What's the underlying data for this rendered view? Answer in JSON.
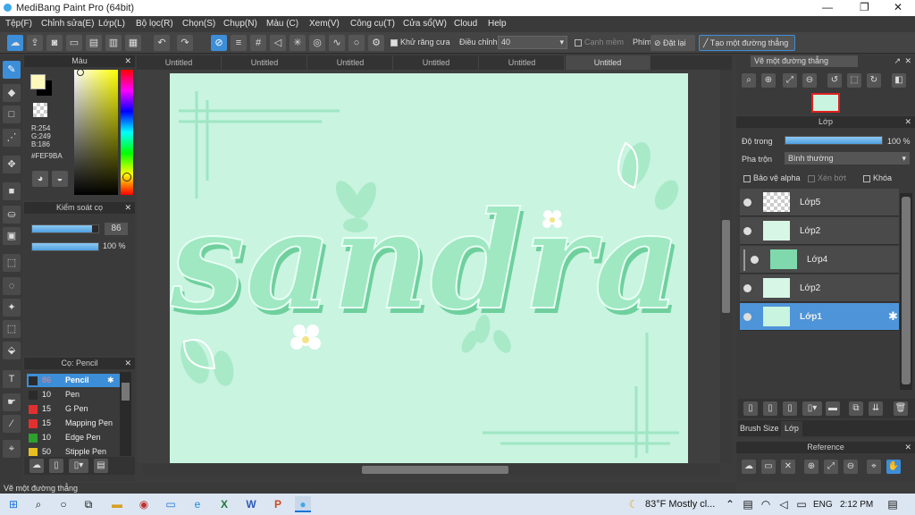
{
  "window": {
    "title": "MediBang Paint Pro (64bit)",
    "min": "—",
    "max": "❐",
    "close": "✕"
  },
  "menu": [
    "Tệp(F)",
    "Chỉnh sửa(E)",
    "Lớp(L)",
    "Bộ lọc(R)",
    "Chọn(S)",
    "Chụp(N)",
    "Màu (C)",
    "Xem(V)",
    "Công cụ(T)",
    "Cửa sổ(W)",
    "Cloud",
    "Help"
  ],
  "toolbar": {
    "antialias_label": "Khử răng cưa",
    "adjust_label": "Điều chỉnh",
    "adjust_value": "40",
    "smooth_label": "Cạnh mềm",
    "key_label": "Phím",
    "reset_label": "Đặt lại",
    "line_label": "Tạo một đường thẳng"
  },
  "color_panel": {
    "title": "Màu",
    "r": "R:254",
    "g": "G:249",
    "b": "B:186",
    "hex": "#FEF9BA",
    "fg_color": "#fef9ba",
    "bg_color": "#000000"
  },
  "brush_control": {
    "title": "Kiểm soát cọ",
    "size": "86",
    "opacity": "100 %",
    "size_fraction": 0.9,
    "opacity_fraction": 1.0
  },
  "brush_panel": {
    "title": "Cọ: Pencil",
    "items": [
      {
        "num": "86",
        "name": "Pencil",
        "color": "#2b2b2b"
      },
      {
        "num": "10",
        "name": "Pen",
        "color": "#2b2b2b"
      },
      {
        "num": "15",
        "name": "G Pen",
        "color": "#e23030"
      },
      {
        "num": "15",
        "name": "Mapping Pen",
        "color": "#e23030"
      },
      {
        "num": "10",
        "name": "Edge Pen",
        "color": "#2ea02e"
      },
      {
        "num": "50",
        "name": "Stipple Pen",
        "color": "#e8c020"
      }
    ]
  },
  "tabs": [
    "Untitled",
    "Untitled",
    "Untitled",
    "Untitled",
    "Untitled",
    "Untitled"
  ],
  "canvas": {
    "lettering": "sandra",
    "bg": "#c8f4e0",
    "ink": "#8fe0b8"
  },
  "navigator": {
    "title": "Vẽ một đường thẳng"
  },
  "layer_panel": {
    "title": "Lớp",
    "opacity_label": "Độ trong",
    "opacity_value": "100 %",
    "blend_label": "Pha trộn",
    "blend_value": "Bình thường",
    "protect_alpha": "Bảo vệ alpha",
    "clip": "Xén bớt",
    "lock": "Khóa",
    "layers": [
      {
        "name": "Lớp5"
      },
      {
        "name": "Lớp2"
      },
      {
        "name": "Lớp4"
      },
      {
        "name": "Lớp2"
      },
      {
        "name": "Lớp1"
      }
    ],
    "tab_brush": "Brush Size",
    "tab_layer": "Lớp"
  },
  "reference": {
    "title": "Reference"
  },
  "status": "Vẽ một đường thẳng",
  "taskbar": {
    "weather": "83°F  Mostly cl...",
    "lang": "ENG",
    "time": "2:12 PM"
  }
}
